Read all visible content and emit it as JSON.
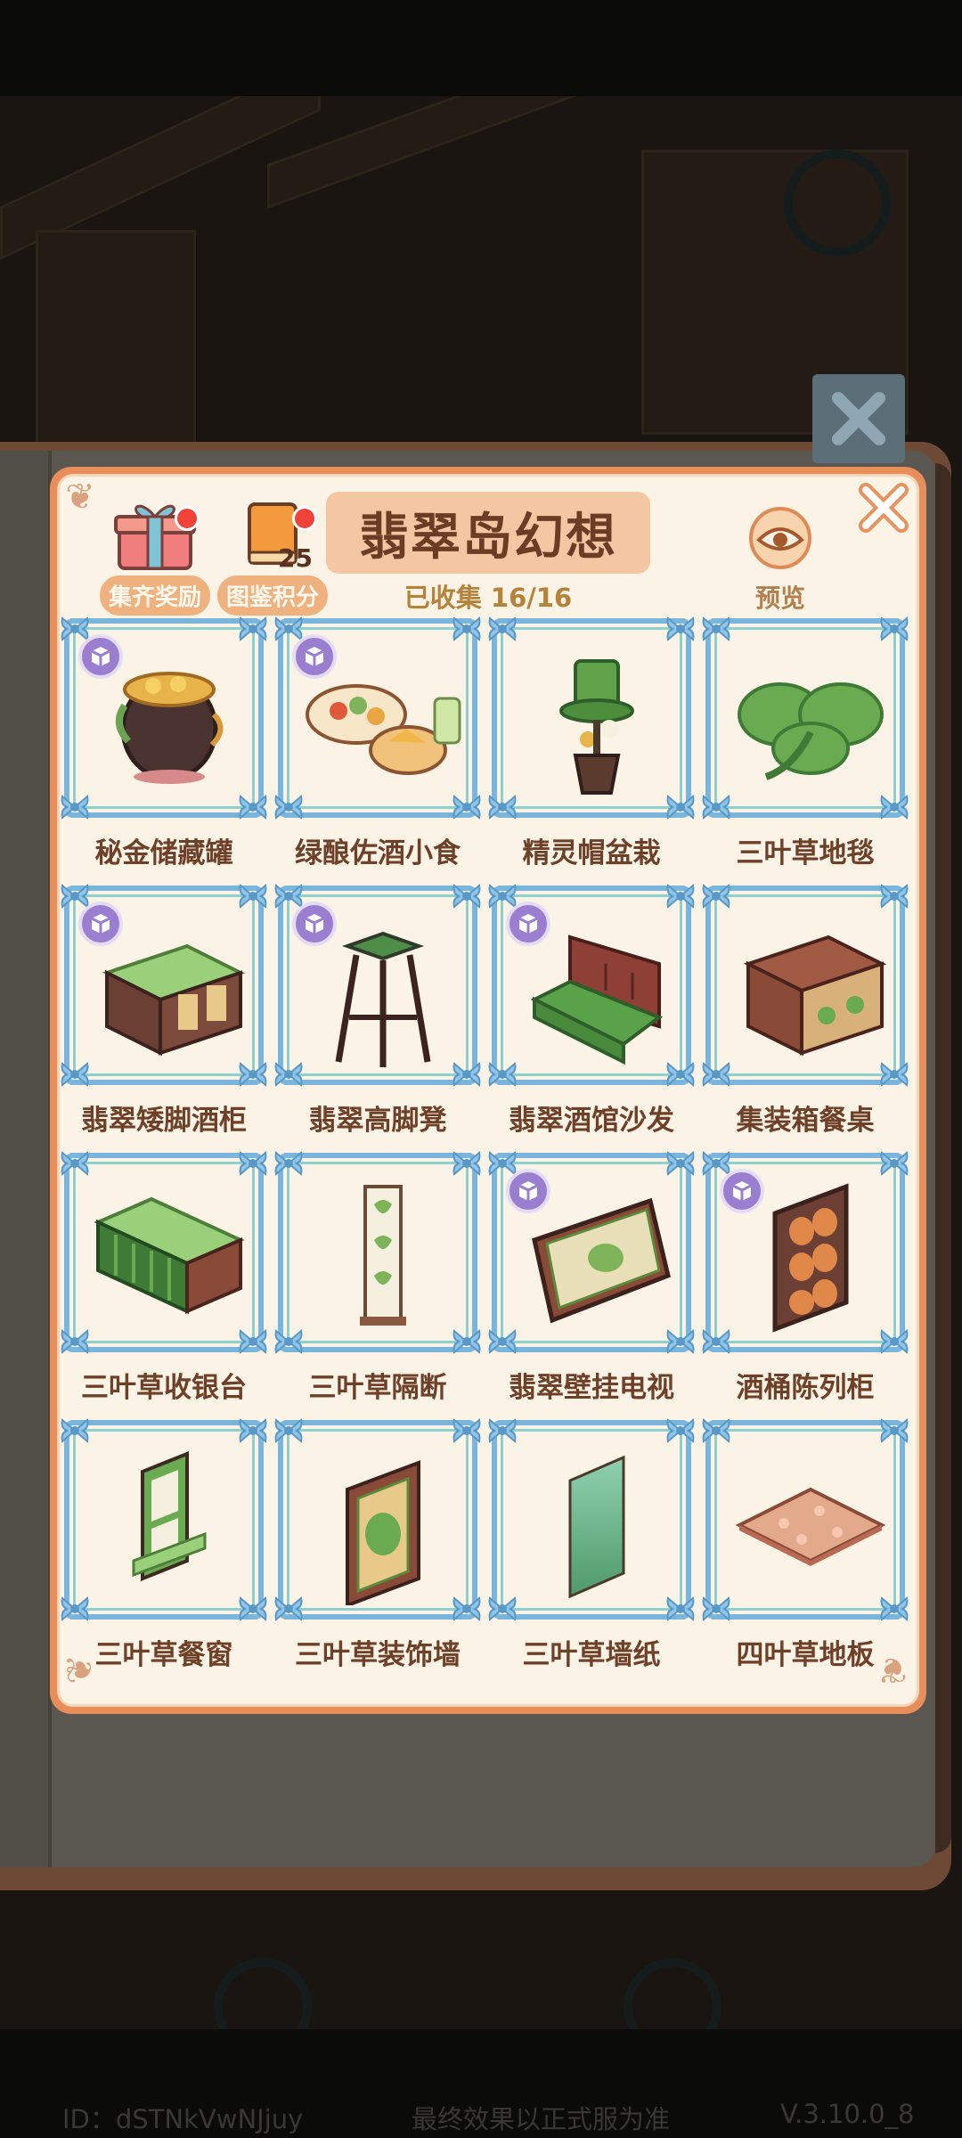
{
  "header": {
    "title": "翡翠岛幻想",
    "collected": "已收集 16/16",
    "reward_label": "集齐奖励",
    "points_label": "图鉴积分",
    "points_value": "25",
    "preview_label": "预览"
  },
  "items": [
    {
      "name": "秘金储藏罐",
      "badge": true,
      "art": "pot-icon"
    },
    {
      "name": "绿酿佐酒小食",
      "badge": true,
      "art": "snack-icon"
    },
    {
      "name": "精灵帽盆栽",
      "badge": false,
      "art": "hat-plant-icon"
    },
    {
      "name": "三叶草地毯",
      "badge": false,
      "art": "clover-rug-icon"
    },
    {
      "name": "翡翠矮脚酒柜",
      "badge": true,
      "art": "cabinet-icon"
    },
    {
      "name": "翡翠高脚凳",
      "badge": true,
      "art": "stool-icon"
    },
    {
      "name": "翡翠酒馆沙发",
      "badge": true,
      "art": "sofa-icon"
    },
    {
      "name": "集装箱餐桌",
      "badge": false,
      "art": "crate-table-icon"
    },
    {
      "name": "三叶草收银台",
      "badge": false,
      "art": "counter-icon"
    },
    {
      "name": "三叶草隔断",
      "badge": false,
      "art": "partition-icon"
    },
    {
      "name": "翡翠壁挂电视",
      "badge": true,
      "art": "tv-icon"
    },
    {
      "name": "酒桶陈列柜",
      "badge": true,
      "art": "barrel-shelf-icon"
    },
    {
      "name": "三叶草餐窗",
      "badge": false,
      "art": "window-icon"
    },
    {
      "name": "三叶草装饰墙",
      "badge": false,
      "art": "deco-wall-icon"
    },
    {
      "name": "三叶草墙纸",
      "badge": false,
      "art": "wallpaper-icon"
    },
    {
      "name": "四叶草地板",
      "badge": false,
      "art": "floor-icon"
    }
  ],
  "footer": {
    "id_text": "ID：dSTNkVwNJjuy",
    "notice": "最终效果以正式服为准",
    "version": "V.3.10.0_8"
  },
  "colors": {
    "panel_border": "#e88e5a",
    "panel_bg": "#fbf3e6",
    "frame_blue": "#7ab5dc",
    "text_brown": "#6e4028",
    "badge_purple": "#9a7fd1"
  }
}
